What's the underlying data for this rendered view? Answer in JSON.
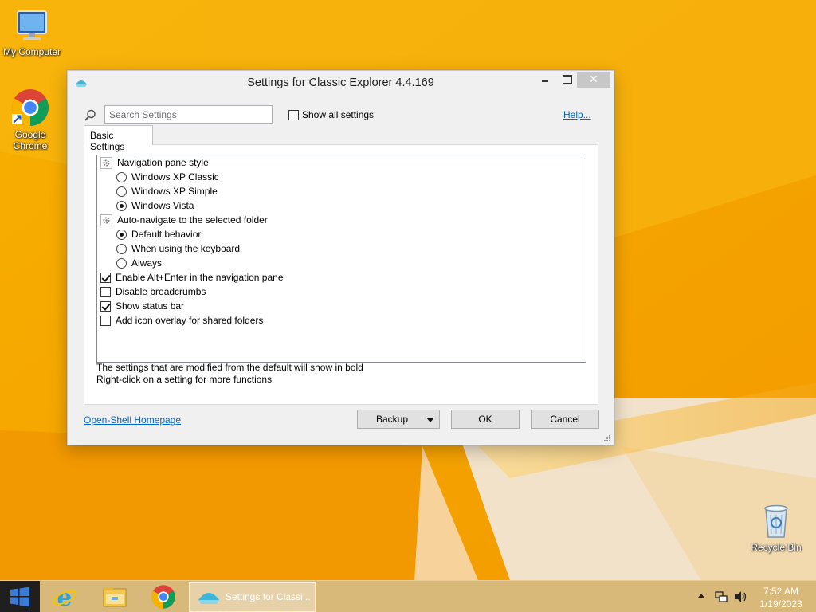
{
  "desktop": {
    "icons": [
      {
        "label": "My Computer",
        "icon": "computer-icon"
      },
      {
        "label": "Google\nChrome",
        "icon": "chrome-icon"
      },
      {
        "label": "Recycle Bin",
        "icon": "recycle-bin-icon"
      }
    ]
  },
  "dialog": {
    "title": "Settings for Classic Explorer 4.4.169",
    "search": {
      "placeholder": "Search Settings",
      "value": ""
    },
    "show_all_label": "Show all settings",
    "show_all_checked": false,
    "help_label": "Help...",
    "tab_label": "Basic Settings",
    "settings": [
      {
        "kind": "group",
        "label": "Navigation pane style"
      },
      {
        "kind": "radio",
        "label": "Windows XP Classic",
        "checked": false
      },
      {
        "kind": "radio",
        "label": "Windows XP Simple",
        "checked": false
      },
      {
        "kind": "radio",
        "label": "Windows Vista",
        "checked": true
      },
      {
        "kind": "group",
        "label": "Auto-navigate to the selected folder"
      },
      {
        "kind": "radio",
        "label": "Default behavior",
        "checked": true
      },
      {
        "kind": "radio",
        "label": "When using the keyboard",
        "checked": false
      },
      {
        "kind": "radio",
        "label": "Always",
        "checked": false
      },
      {
        "kind": "check",
        "label": "Enable Alt+Enter in the navigation pane",
        "checked": true
      },
      {
        "kind": "check",
        "label": "Disable breadcrumbs",
        "checked": false
      },
      {
        "kind": "check",
        "label": "Show status bar",
        "checked": true
      },
      {
        "kind": "check",
        "label": "Add icon overlay for shared folders",
        "checked": false
      }
    ],
    "hint_line1": "The settings that are modified from the default will show in bold",
    "hint_line2": "Right-click on a setting for more functions",
    "homepage_label": "Open-Shell Homepage",
    "backup_label": "Backup",
    "ok_label": "OK",
    "cancel_label": "Cancel"
  },
  "taskbar": {
    "pinned": [
      "internet-explorer-icon",
      "file-explorer-icon",
      "chrome-icon"
    ],
    "active_window_label": "Settings for Classi...",
    "time": "7:52 AM",
    "date": "1/19/2023"
  },
  "colors": {
    "wallpaper_orange": "#f5a800",
    "taskbar": "#d9b97a",
    "link": "#0066cc"
  }
}
